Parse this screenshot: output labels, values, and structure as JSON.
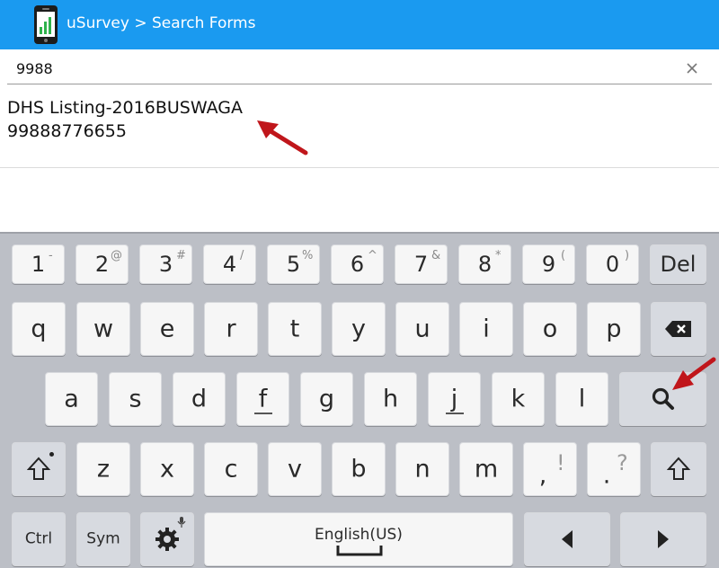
{
  "app": {
    "title": "uSurvey > Search Forms",
    "logo_icon": "phone-chart-icon",
    "bar_color": "#1a9af0"
  },
  "search": {
    "value": "9988",
    "clear_icon": "close-icon"
  },
  "results": [
    {
      "title": "DHS Listing-2016BUSWAGA",
      "subtitle": "99888776655"
    }
  ],
  "annotation_color": "#c0161b",
  "keyboard": {
    "rows": [
      [
        {
          "label": "1",
          "sup": "-"
        },
        {
          "label": "2",
          "sup": "@"
        },
        {
          "label": "3",
          "sup": "#"
        },
        {
          "label": "4",
          "sup": "/"
        },
        {
          "label": "5",
          "sup": "%"
        },
        {
          "label": "6",
          "sup": "^"
        },
        {
          "label": "7",
          "sup": "&"
        },
        {
          "label": "8",
          "sup": "*"
        },
        {
          "label": "9",
          "sup": "("
        },
        {
          "label": "0",
          "sup": ")"
        },
        {
          "label": "Del"
        }
      ],
      [
        {
          "label": "q"
        },
        {
          "label": "w"
        },
        {
          "label": "e"
        },
        {
          "label": "r"
        },
        {
          "label": "t"
        },
        {
          "label": "y"
        },
        {
          "label": "u"
        },
        {
          "label": "i"
        },
        {
          "label": "o"
        },
        {
          "label": "p"
        },
        {
          "label": "",
          "icon": "backspace-icon"
        }
      ],
      [
        {
          "label": "a"
        },
        {
          "label": "s"
        },
        {
          "label": "d"
        },
        {
          "label": "f"
        },
        {
          "label": "g"
        },
        {
          "label": "h"
        },
        {
          "label": "j"
        },
        {
          "label": "k"
        },
        {
          "label": "l"
        },
        {
          "label": "",
          "icon": "search-icon"
        }
      ],
      [
        {
          "label": "",
          "icon": "shift-icon"
        },
        {
          "label": "z"
        },
        {
          "label": "x"
        },
        {
          "label": "c"
        },
        {
          "label": "v"
        },
        {
          "label": "b"
        },
        {
          "label": "n"
        },
        {
          "label": "m"
        },
        {
          "label": ",",
          "sup": "!"
        },
        {
          "label": ".",
          "sup": "?"
        },
        {
          "label": "",
          "icon": "shift-icon"
        }
      ],
      [
        {
          "label": "Ctrl"
        },
        {
          "label": "Sym"
        },
        {
          "label": "",
          "icon": "settings-icon"
        },
        {
          "label": "English(US)",
          "icon": "space-icon"
        },
        {
          "label": "",
          "icon": "arrow-left-icon"
        },
        {
          "label": "",
          "icon": "arrow-right-icon"
        }
      ]
    ]
  }
}
